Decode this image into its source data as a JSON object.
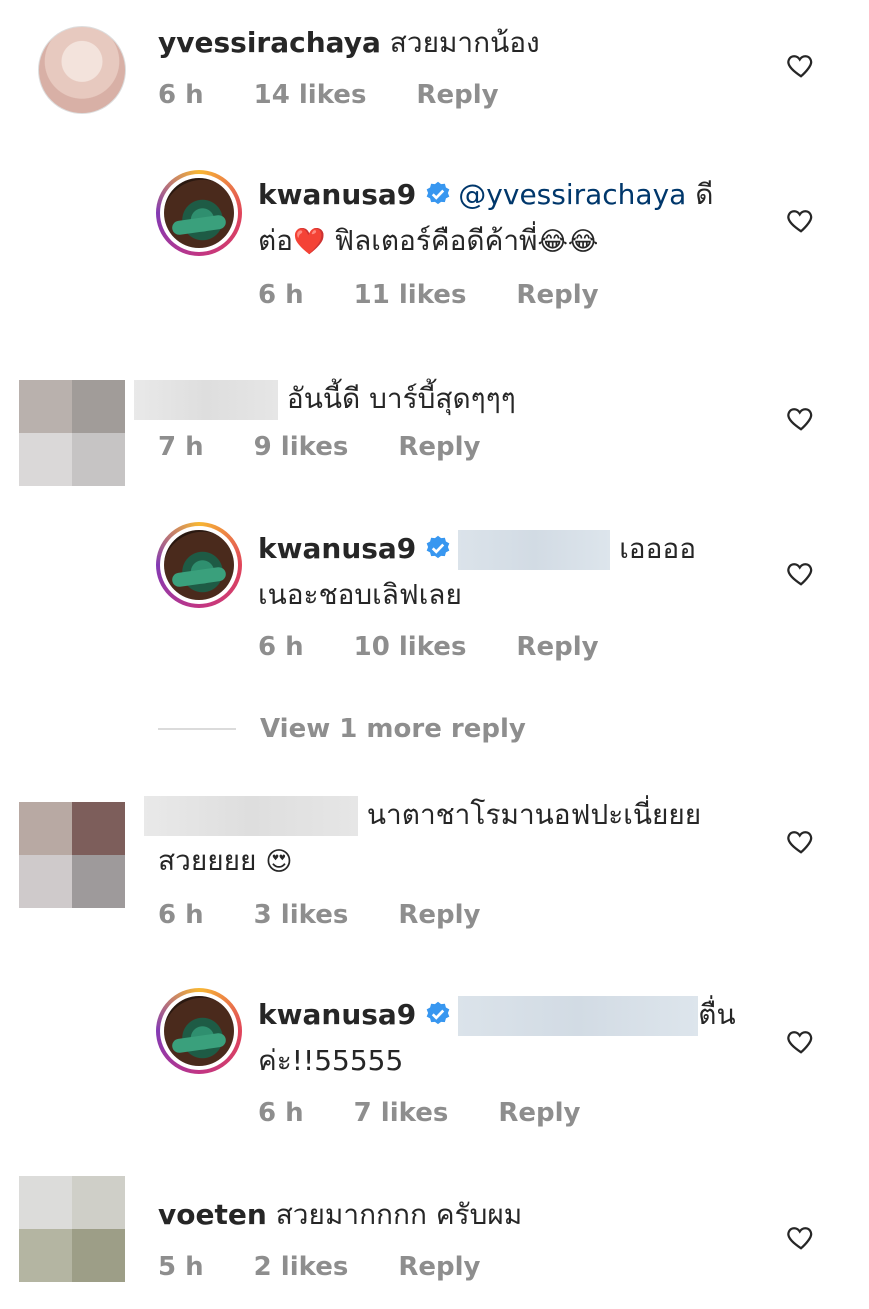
{
  "comments": [
    {
      "username": "yvessirachaya",
      "text": "สวยมากน้อง",
      "time": "6 h",
      "likes": "14 likes",
      "reply": "Reply"
    },
    {
      "username": "kwanusa9",
      "mention": "@yvessirachaya",
      "text_a": "ดี",
      "text_b": "ต่อ",
      "text_c": "ฟิลเตอร์คือดีค้าพี่",
      "time": "6 h",
      "likes": "11 likes",
      "reply": "Reply"
    },
    {
      "text": "อันนี้ดี บาร์บี้สุดๆๆๆ",
      "time": "7 h",
      "likes": "9 likes",
      "reply": "Reply"
    },
    {
      "username": "kwanusa9",
      "text_a": "เออออ",
      "text_b": "เนอะชอบเลิฟเลย",
      "time": "6 h",
      "likes": "10 likes",
      "reply": "Reply"
    },
    {
      "text_a": "นาตาชาโรมานอฟปะเนี่ยยย",
      "text_b": "สวยยยย",
      "time": "6 h",
      "likes": "3 likes",
      "reply": "Reply"
    },
    {
      "username": "kwanusa9",
      "text_a": "ตื่น",
      "text_b": "ค่ะ!!55555",
      "time": "6 h",
      "likes": "7 likes",
      "reply": "Reply"
    },
    {
      "username": "voeten",
      "text": "สวยมากกกก ครับผม",
      "time": "5 h",
      "likes": "2 likes",
      "reply": "Reply"
    }
  ],
  "view_more": "View 1 more reply",
  "emoji": {
    "heart": "❤️",
    "laugh": "😂😂",
    "heart_eyes": "😍"
  },
  "colors": {
    "meta": "#8e8e8e",
    "verified": "#3897f0",
    "mention": "#00376b"
  },
  "icons": {
    "like": "heart-outline-icon",
    "verified": "verified-badge-icon"
  }
}
